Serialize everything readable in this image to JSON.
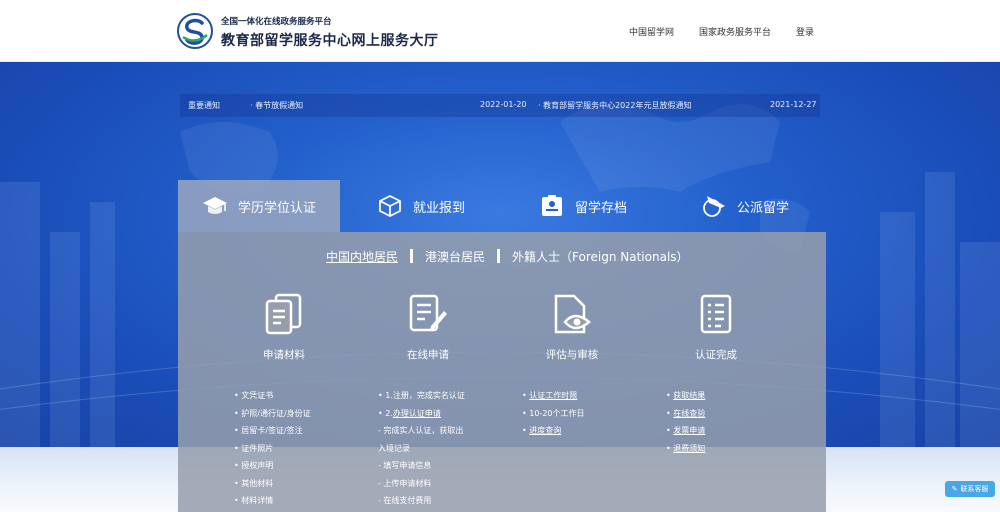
{
  "header": {
    "subtitle": "全国一体化在线政务服务平台",
    "title": "教育部留学服务中心网上服务大厅",
    "nav": [
      "中国留学网",
      "国家政务服务平台",
      "登录"
    ]
  },
  "notice": {
    "label": "重要通知",
    "items": [
      {
        "text": "· 春节放假通知",
        "date": "2022-01-20"
      },
      {
        "text": "· 教育部留学服务中心2022年元旦放假通知",
        "date": "2021-12-27"
      }
    ]
  },
  "tabs": [
    "学历学位认证",
    "就业报到",
    "留学存档",
    "公派留学"
  ],
  "subtabs": [
    "中国内地居民",
    "港澳台居民",
    "外籍人士（Foreign Nationals）"
  ],
  "steps": [
    "申请材料",
    "在线申请",
    "评估与审核",
    "认证完成"
  ],
  "columns": {
    "materials": [
      "• 文凭证书",
      "• 护照/通行证/身份证",
      "• 居留卡/签证/签注",
      "• 证件照片",
      "• 授权声明",
      "• 其他材料",
      "• 材料详情"
    ],
    "apply": [
      "• 1.注册，完成实名认证",
      "• 2.",
      "办理认证申请",
      "- 完成实人认证，获取出",
      "入境记录",
      "- 填写申请信息",
      "- 上传申请材料",
      "- 在线支付费用"
    ],
    "review_prefix": "• ",
    "review": [
      "认证工作时限",
      "10-20个工作日",
      "进度查询"
    ],
    "done": [
      "获取结果",
      "在线查验",
      "发票申请",
      "退费须知"
    ]
  },
  "float_button": "联系客服",
  "colors": {
    "hero": "#2360cc",
    "panel": "#969eac",
    "float": "#4aa7e6"
  }
}
